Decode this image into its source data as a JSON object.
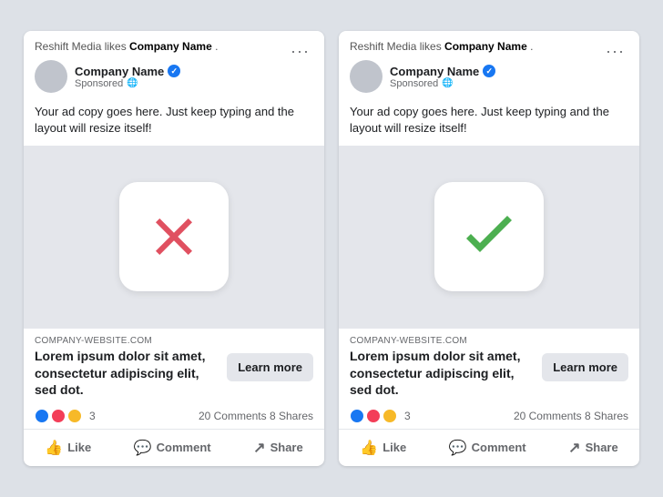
{
  "cards": [
    {
      "id": "card-x",
      "likes_line_prefix": "Reshift Media likes ",
      "company_bold": "Company Name",
      "likes_line_suffix": ".",
      "company_name": "Company Name",
      "sponsored_label": "Sponsored",
      "ad_copy": "Your ad copy goes here. Just keep typing and the layout will resize itself!",
      "icon_type": "x",
      "url_label": "COMPANY-WEBSITE.COM",
      "headline": "Lorem ipsum dolor sit amet, consectetur adipiscing elit, sed dot.",
      "learn_more": "Learn more",
      "reactions_count": "3",
      "comments_shares": "20 Comments  8 Shares",
      "like_label": "Like",
      "comment_label": "Comment",
      "share_label": "Share"
    },
    {
      "id": "card-check",
      "likes_line_prefix": "Reshift Media likes ",
      "company_bold": "Company Name",
      "likes_line_suffix": ".",
      "company_name": "Company Name",
      "sponsored_label": "Sponsored",
      "ad_copy": "Your ad copy goes here. Just keep typing and the layout will resize itself!",
      "icon_type": "check",
      "url_label": "COMPANY-WEBSITE.COM",
      "headline": "Lorem ipsum dolor sit amet, consectetur adipiscing elit, sed dot.",
      "learn_more": "Learn more",
      "reactions_count": "3",
      "comments_shares": "20 Comments  8 Shares",
      "like_label": "Like",
      "comment_label": "Comment",
      "share_label": "Share"
    }
  ]
}
